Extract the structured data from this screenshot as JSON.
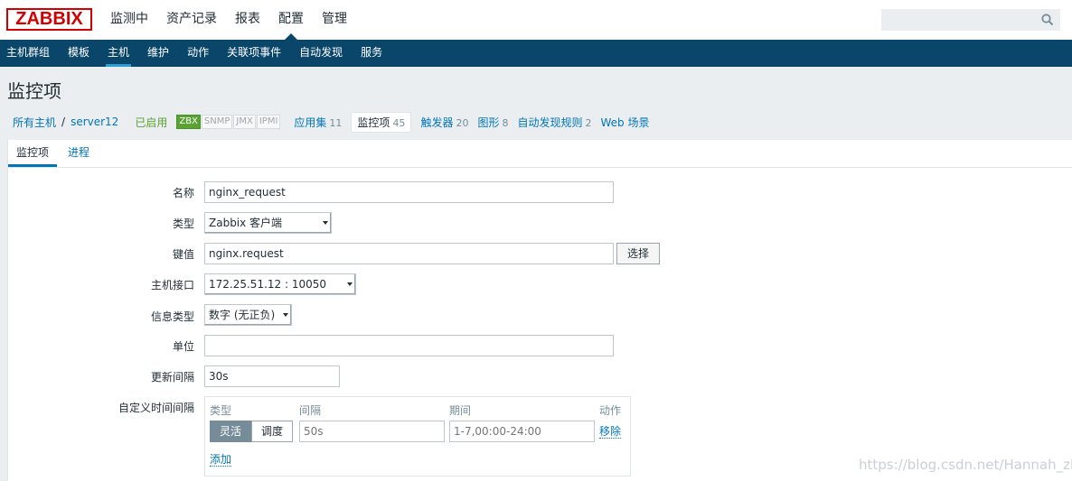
{
  "header": {
    "logo": "ZABBIX",
    "menu": [
      "监测中",
      "资产记录",
      "报表",
      "配置",
      "管理"
    ],
    "active_menu": "配置",
    "search_value": ""
  },
  "submenu": {
    "items": [
      "主机群组",
      "模板",
      "主机",
      "维护",
      "动作",
      "关联项事件",
      "自动发现",
      "服务"
    ],
    "active": "主机"
  },
  "page_title": "监控项",
  "breadcrumb": {
    "all_hosts": "所有主机",
    "separator": "/",
    "host": "server12",
    "status": "已启用",
    "availability": [
      "ZBX",
      "SNMP",
      "JMX",
      "IPMI"
    ],
    "links": [
      {
        "label": "应用集",
        "count": "11"
      },
      {
        "label": "监控项",
        "count": "45"
      },
      {
        "label": "触发器",
        "count": "20"
      },
      {
        "label": "图形",
        "count": "8"
      },
      {
        "label": "自动发现规则",
        "count": "2"
      },
      {
        "label": "Web 场景",
        "count": ""
      }
    ]
  },
  "tabs": [
    "监控项",
    "进程"
  ],
  "form": {
    "name_label": "名称",
    "name_value": "nginx_request",
    "type_label": "类型",
    "type_value": "Zabbix 客户端",
    "key_label": "键值",
    "key_value": "nginx.request",
    "key_select_button": "选择",
    "interface_label": "主机接口",
    "interface_value": "172.25.51.12 : 10050",
    "info_type_label": "信息类型",
    "info_type_value": "数字 (无正负)",
    "units_label": "单位",
    "units_value": "",
    "update_label": "更新间隔",
    "update_value": "30s",
    "custom_label": "自定义时间间隔",
    "custom": {
      "col_type": "类型",
      "col_interval": "间隔",
      "col_period": "期间",
      "col_action": "动作",
      "seg_flexible": "灵活",
      "seg_scheduling": "调度",
      "interval_placeholder": "50s",
      "period_placeholder": "1-7,00:00-24:00",
      "remove_label": "移除",
      "add_label": "添加"
    }
  },
  "watermark": "https://blog.csdn.net/Hannah_zh",
  "colors": {
    "brand": "#d40000",
    "nav": "#0a466a",
    "link": "#0275b8",
    "enabled": "#59a333"
  }
}
